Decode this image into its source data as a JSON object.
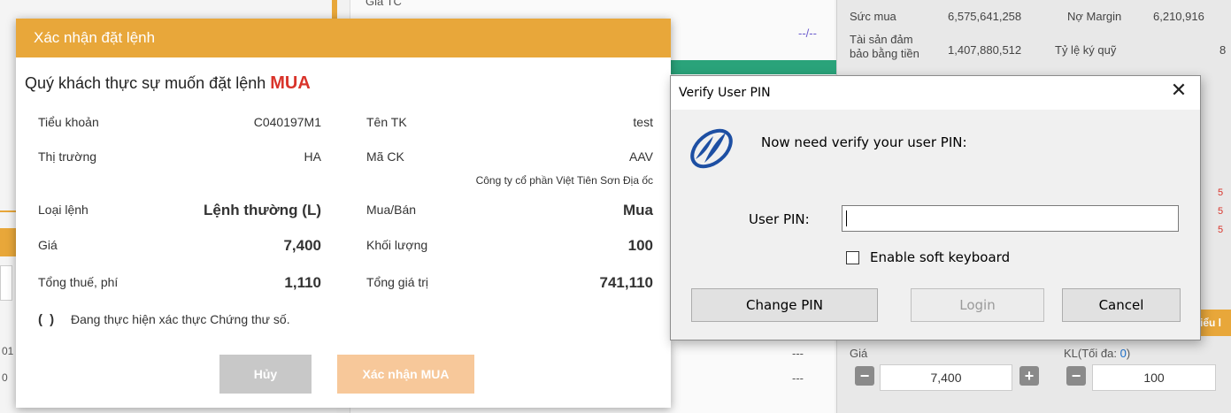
{
  "background": {
    "left_texts": [
      "01",
      "0"
    ],
    "center": {
      "top_label": "Giá TC",
      "dash": "--/--",
      "row_dashes": [
        "---",
        "---"
      ]
    },
    "account": {
      "purchasing_power_label": "Sức mua",
      "purchasing_power_value": "6,575,641,258",
      "margin_debt_label": "Nợ Margin",
      "margin_debt_value": "6,210,916",
      "collateral_label_1": "Tài sản đảm",
      "collateral_label_2": "bảo bằng tiền",
      "collateral_value": "1,407,880,512",
      "deposit_ratio_label": "Tỷ lệ ký quỹ",
      "deposit_ratio_value": "8"
    },
    "right_edge_reds": [
      "5",
      "5",
      "5"
    ],
    "right_orange_button": "iểu l",
    "order_form": {
      "price_label": "Giá",
      "qty_label_prefix": "KL(Tối đa: ",
      "qty_max": "0",
      "qty_label_suffix": ")",
      "price_value": "7,400",
      "qty_value": "100",
      "minus": "−",
      "plus": "+"
    }
  },
  "modal": {
    "title": "Xác nhận đặt lệnh",
    "question_prefix": "Quý khách thực sự muốn đặt lệnh",
    "side": "MUA",
    "rows": {
      "sub_account_label": "Tiểu khoản",
      "sub_account_value": "C040197M1",
      "account_name_label": "Tên TK",
      "account_name_value": "test",
      "market_label": "Thị trường",
      "market_value": "HA",
      "symbol_label": "Mã CK",
      "symbol_value": "AAV",
      "company_name": "Công ty cổ phần Việt Tiên Sơn Địa ốc",
      "order_type_label": "Loại lệnh",
      "order_type_value": "Lệnh thường (L)",
      "buy_sell_label": "Mua/Bán",
      "buy_sell_value": "Mua",
      "price_label": "Giá",
      "price_value": "7,400",
      "quantity_label": "Khối lượng",
      "quantity_value": "100",
      "total_fee_label": "Tổng thuế, phí",
      "total_fee_value": "1,110",
      "total_value_label": "Tổng giá trị",
      "total_value_value": "741,110"
    },
    "spinner_glyph": "( )",
    "cert_status": "Đang thực hiện xác thực Chứng thư số.",
    "cancel_label": "Hủy",
    "confirm_label": "Xác nhận MUA"
  },
  "pin_dialog": {
    "title": "Verify User PIN",
    "close_glyph": "✕",
    "message": "Now need verify your user PIN:",
    "pin_label": "User PIN:",
    "pin_value": "",
    "soft_keyboard_label": "Enable soft keyboard",
    "soft_keyboard_checked": false,
    "change_pin_label": "Change PIN",
    "login_label": "Login",
    "cancel_label": "Cancel"
  },
  "colors": {
    "brand_orange": "#e8a73a",
    "buy_red": "#d9342b",
    "logo_blue": "#1d4fa3"
  }
}
